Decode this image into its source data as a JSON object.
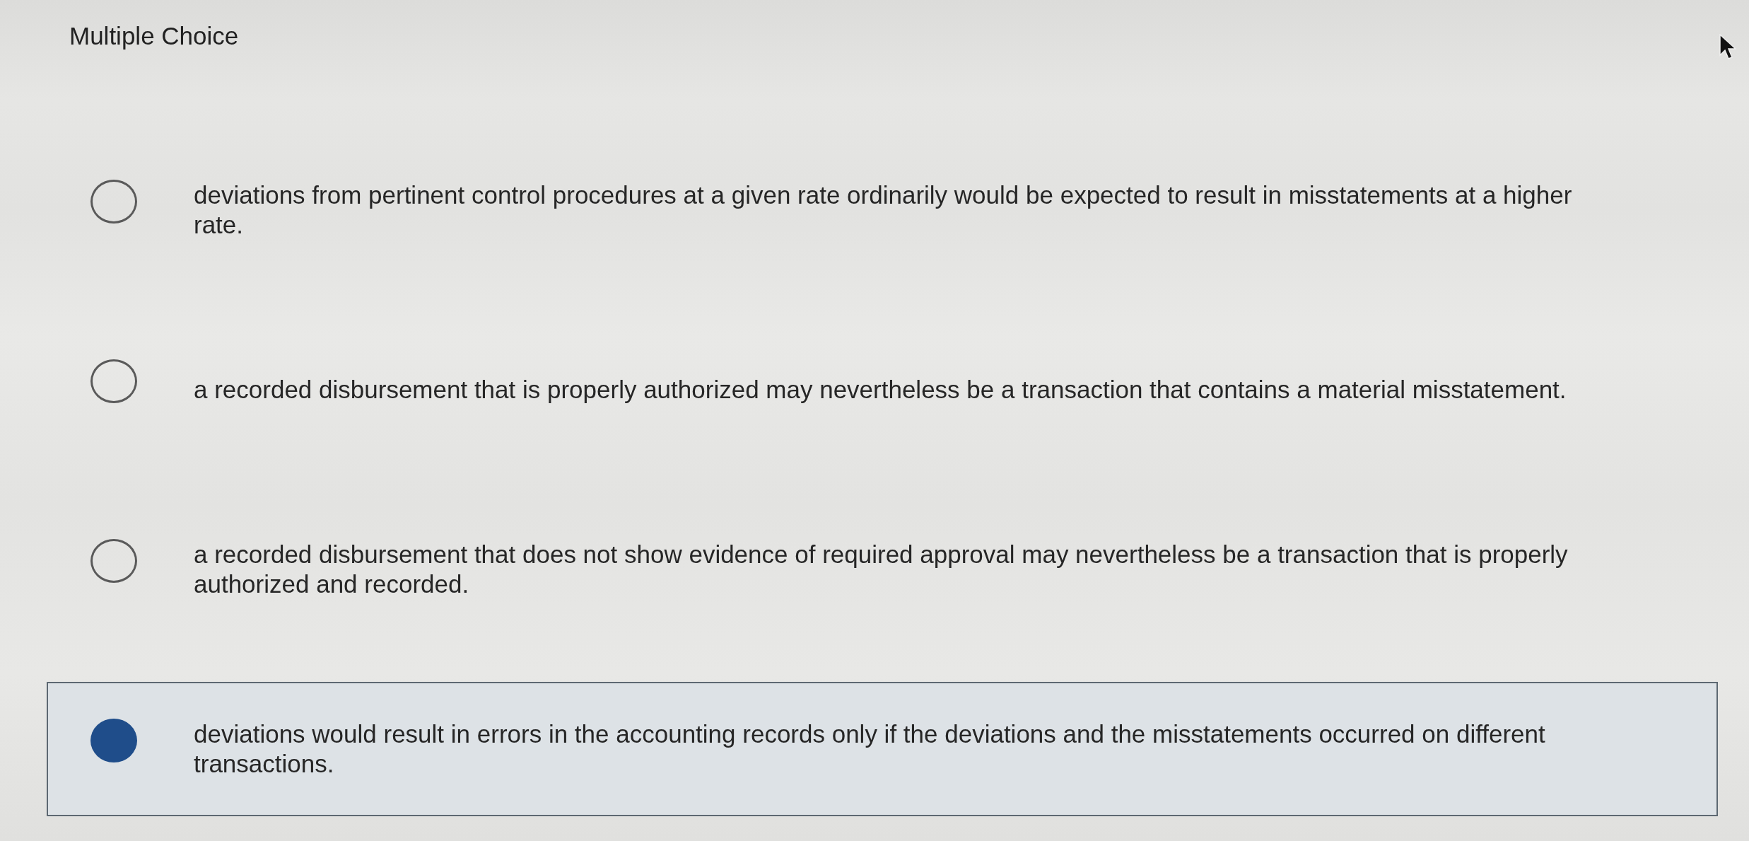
{
  "title": "Multiple Choice",
  "options": [
    {
      "text": "deviations from pertinent control procedures at a given rate ordinarily would be expected to result in misstatements at a higher rate.",
      "selected": false
    },
    {
      "text": "a recorded disbursement that is properly authorized may nevertheless be a transaction that contains a material misstatement.",
      "selected": false
    },
    {
      "text": "a recorded disbursement that does not show evidence of required approval may nevertheless be a transaction that is properly authorized and recorded.",
      "selected": false
    },
    {
      "text": "deviations would result in errors in the accounting records only if the deviations and the misstatements occurred on different transactions.",
      "selected": true
    }
  ]
}
